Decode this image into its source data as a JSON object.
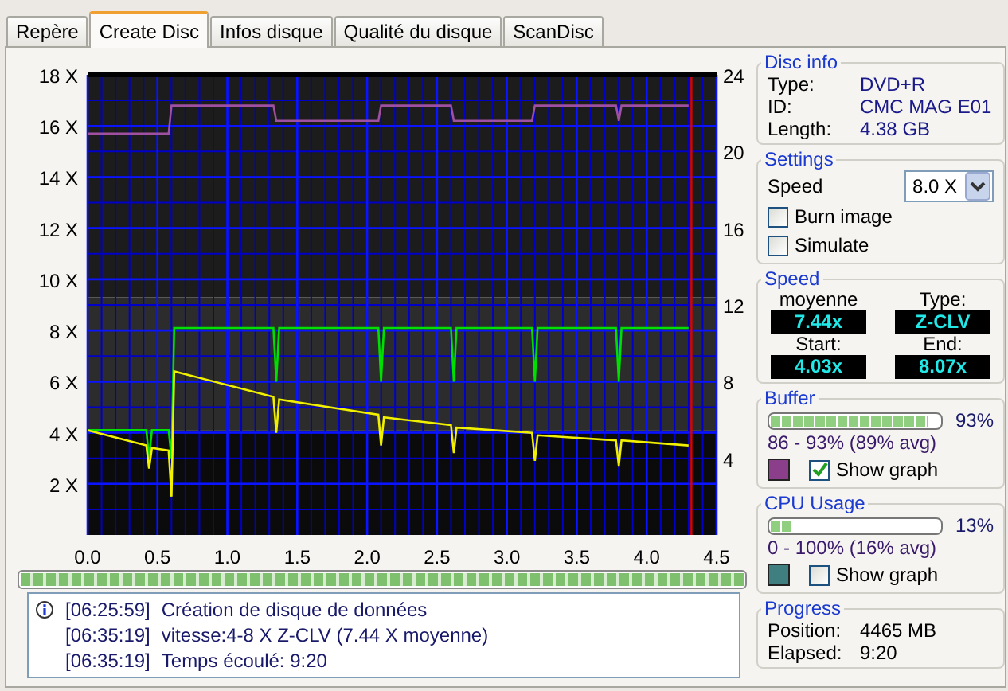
{
  "tabs": [
    {
      "label": "Repère",
      "selected": false
    },
    {
      "label": "Create Disc",
      "selected": true
    },
    {
      "label": "Infos disque",
      "selected": false
    },
    {
      "label": "Qualité du disque",
      "selected": false
    },
    {
      "label": "ScanDisc",
      "selected": false
    }
  ],
  "chart_data": {
    "type": "line",
    "grid": true,
    "xlim": [
      0,
      4.5
    ],
    "ylim": [
      0,
      18
    ],
    "xticks": [
      {
        "value": 0,
        "label": "0.0"
      },
      {
        "value": 0.5,
        "label": "0.5"
      },
      {
        "value": 1,
        "label": "1.0"
      },
      {
        "value": 1.5,
        "label": "1.5"
      },
      {
        "value": 2,
        "label": "2.0"
      },
      {
        "value": 2.5,
        "label": "2.5"
      },
      {
        "value": 3,
        "label": "3.0"
      },
      {
        "value": 3.5,
        "label": "3.5"
      },
      {
        "value": 4,
        "label": "4.0"
      },
      {
        "value": 4.5,
        "label": "4.5"
      }
    ],
    "yticks": [
      {
        "value": 2,
        "label": "2 X"
      },
      {
        "value": 4,
        "label": "4 X"
      },
      {
        "value": 6,
        "label": "6 X"
      },
      {
        "value": 8,
        "label": "8 X"
      },
      {
        "value": 10,
        "label": "10 X"
      },
      {
        "value": 12,
        "label": "12 X"
      },
      {
        "value": 14,
        "label": "14 X"
      },
      {
        "value": 16,
        "label": "16 X"
      },
      {
        "value": 18,
        "label": "18 X"
      }
    ],
    "x": [
      0,
      0.42,
      0.44,
      0.46,
      0.58,
      0.6,
      0.62,
      1.33,
      1.35,
      1.37,
      2.08,
      2.1,
      2.12,
      2.6,
      2.62,
      2.64,
      3.18,
      3.2,
      3.22,
      3.78,
      3.8,
      3.82,
      4.3
    ],
    "series": [
      {
        "color": "#00e000",
        "values": [
          4.1,
          4.1,
          3.0,
          4.1,
          4.1,
          3.0,
          8.1,
          8.1,
          6.0,
          8.1,
          8.1,
          6.0,
          8.1,
          8.1,
          6.0,
          8.1,
          8.1,
          6.0,
          8.1,
          8.1,
          6.0,
          8.1,
          8.1
        ]
      },
      {
        "color": "#f0f000",
        "values": [
          4.1,
          3.5,
          2.6,
          3.4,
          3.3,
          1.5,
          6.4,
          5.4,
          4.0,
          5.3,
          4.7,
          3.5,
          4.6,
          4.3,
          3.2,
          4.2,
          4.0,
          2.9,
          3.9,
          3.7,
          2.7,
          3.7,
          3.5
        ]
      },
      {
        "color": "#a050a0",
        "values": [
          15.7,
          15.7,
          15.7,
          15.7,
          15.7,
          16.8,
          16.8,
          16.8,
          16.2,
          16.2,
          16.2,
          16.8,
          16.8,
          16.8,
          16.2,
          16.2,
          16.2,
          16.8,
          16.8,
          16.8,
          16.2,
          16.8,
          16.8
        ]
      }
    ],
    "bands": [
      {
        "axis": "y",
        "from": 9.3,
        "to": 18,
        "color": "#1c1c1c"
      },
      {
        "axis": "y",
        "from": 4.1,
        "to": 9.3,
        "color": "#2c2c2c"
      },
      {
        "axis": "y",
        "from": 0,
        "to": 4.1,
        "color": "#0b0b0b"
      }
    ],
    "ref_lines": [
      {
        "axis": "x",
        "value": 4.32,
        "color": "#e00000"
      }
    ]
  },
  "right_axis": {
    "ticks": [
      "24",
      "20",
      "16",
      "12",
      "8",
      "4"
    ]
  },
  "progress_bar": {
    "level": 1
  },
  "log": [
    {
      "kind": "info",
      "time": "[06:25:59]",
      "text": "Création de disque de données"
    },
    {
      "kind": "plain",
      "time": "[06:35:19]",
      "text": "vitesse:4-8 X Z-CLV (7.44 X moyenne)"
    },
    {
      "kind": "plain",
      "time": "[06:35:19]",
      "text": "Temps écoulé:  9:20"
    }
  ],
  "disc_info": {
    "title": "Disc info",
    "rows": [
      {
        "label": "Type:",
        "value": "DVD+R"
      },
      {
        "label": "ID:",
        "value": "CMC MAG E01"
      },
      {
        "label": "Length:",
        "value": "4.38 GB"
      }
    ]
  },
  "settings": {
    "title": "Settings",
    "speed_label": "Speed",
    "speed_value": "8.0 X",
    "options": [
      {
        "label": "Burn image",
        "checked": false
      },
      {
        "label": "Simulate",
        "checked": false
      }
    ]
  },
  "speed": {
    "title": "Speed",
    "readouts": [
      {
        "label": "moyenne",
        "value": "7.44x"
      },
      {
        "label": "Type:",
        "value": "Z-CLV"
      },
      {
        "label": "Start:",
        "value": "4.03x"
      },
      {
        "label": "End:",
        "value": "8.07x"
      }
    ]
  },
  "buffer": {
    "title": "Buffer",
    "level": 0.93,
    "reading": "93%",
    "range": "86 - 93% (89% avg)",
    "color": "#8b3f8b",
    "show_graph_label": "Show graph",
    "show_graph": true
  },
  "cpu_usage": {
    "title": "CPU Usage",
    "level": 0.13,
    "reading": "13%",
    "range": "0 - 100% (16% avg)",
    "color": "#3f7f7f",
    "show_graph_label": "Show graph",
    "show_graph": false
  },
  "progress": {
    "title": "Progress",
    "rows": [
      {
        "label": "Position:",
        "value": "4465 MB"
      },
      {
        "label": "Elapsed:",
        "value": "9:20"
      }
    ]
  }
}
